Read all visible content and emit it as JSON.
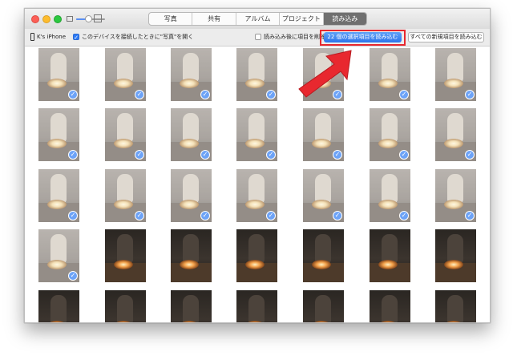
{
  "tabs": [
    {
      "label": "写真",
      "active": false
    },
    {
      "label": "共有",
      "active": false
    },
    {
      "label": "アルバム",
      "active": false
    },
    {
      "label": "プロジェクト",
      "active": false
    },
    {
      "label": "読み込み",
      "active": true
    }
  ],
  "import_bar": {
    "device_name": "K's iPhone",
    "open_photos_checked": true,
    "open_photos_label": "このデバイスを接続したときに\"写真\"を開く",
    "delete_after_import_checked": false,
    "delete_after_import_label": "読み込み後に項目を削除",
    "import_selected_label": "22 個の選択項目を読み込む",
    "import_all_label": "すべての新規項目を読み込む"
  },
  "annotation": {
    "highlight_color": "#e8282f",
    "arrow_color": "#e8282f"
  },
  "colors": {
    "accent": "#2f7cf6",
    "active_tab": "#6f6f6f"
  },
  "thumbnails": [
    {
      "style": "dim",
      "selected": true
    },
    {
      "style": "dim",
      "selected": true
    },
    {
      "style": "dim",
      "selected": true
    },
    {
      "style": "dim",
      "selected": true
    },
    {
      "style": "dim",
      "selected": true
    },
    {
      "style": "dim",
      "selected": true
    },
    {
      "style": "dim",
      "selected": true
    },
    {
      "style": "dim",
      "selected": true
    },
    {
      "style": "dim",
      "selected": true
    },
    {
      "style": "dim",
      "selected": true
    },
    {
      "style": "dim",
      "selected": true
    },
    {
      "style": "dim",
      "selected": true
    },
    {
      "style": "dim",
      "selected": true
    },
    {
      "style": "dim",
      "selected": true
    },
    {
      "style": "dim",
      "selected": true
    },
    {
      "style": "dim",
      "selected": true
    },
    {
      "style": "dim",
      "selected": true
    },
    {
      "style": "dim",
      "selected": true
    },
    {
      "style": "dim",
      "selected": true
    },
    {
      "style": "dim",
      "selected": true
    },
    {
      "style": "dim",
      "selected": true
    },
    {
      "style": "dim",
      "selected": true
    },
    {
      "style": "dark",
      "selected": false
    },
    {
      "style": "dark",
      "selected": false
    },
    {
      "style": "dark",
      "selected": false
    },
    {
      "style": "dark",
      "selected": false
    },
    {
      "style": "dark",
      "selected": false
    },
    {
      "style": "dark",
      "selected": false
    },
    {
      "style": "dark",
      "selected": false
    },
    {
      "style": "dark",
      "selected": false
    },
    {
      "style": "dark",
      "selected": false
    },
    {
      "style": "dark",
      "selected": false
    },
    {
      "style": "dark",
      "selected": false
    },
    {
      "style": "dark",
      "selected": false
    },
    {
      "style": "dark",
      "selected": false
    }
  ]
}
